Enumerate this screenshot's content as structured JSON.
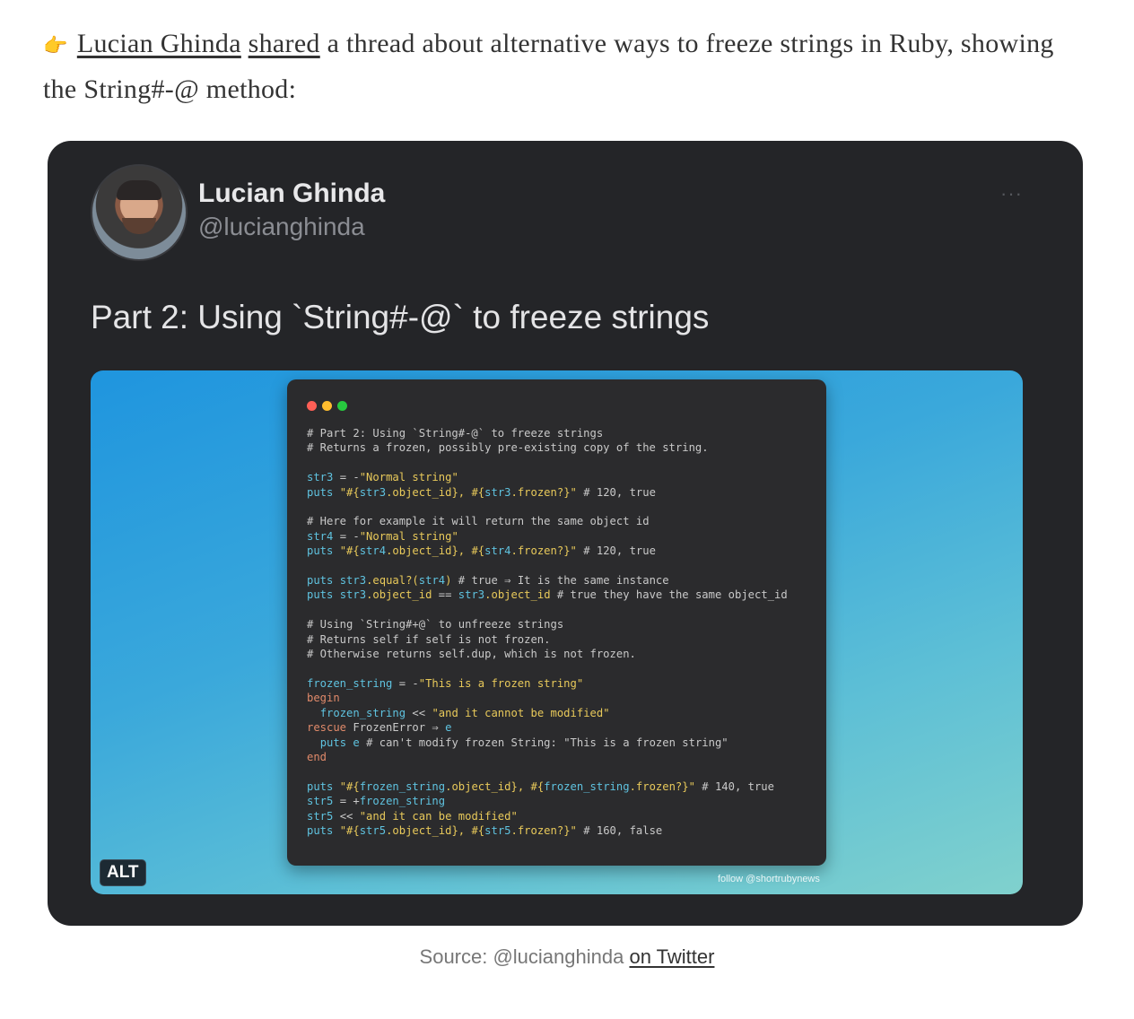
{
  "intro": {
    "emoji": "👉",
    "author_link": "Lucian Ghinda",
    "shared_link": "shared",
    "text_after": "a thread about alternative ways to freeze strings in Ruby, showing the String#-@ method:"
  },
  "tweet": {
    "name": "Lucian Ghinda",
    "handle": "@lucianghinda",
    "more": "···",
    "text": "Part 2: Using `String#-@` to freeze strings",
    "alt_badge": "ALT",
    "watermark": "follow @shortrubynews",
    "window_dots": [
      "#ff5f56",
      "#ffbd2e",
      "#27c93f"
    ],
    "code_lines": [
      [
        [
          "c",
          "# Part 2: Using `String#-@` to freeze strings"
        ]
      ],
      [
        [
          "c",
          "# Returns a frozen, possibly pre-existing copy of the string."
        ]
      ],
      [],
      [
        [
          "v",
          "str3"
        ],
        [
          "c",
          " = -"
        ],
        [
          "s",
          "\"Normal string\""
        ]
      ],
      [
        [
          "v",
          "puts"
        ],
        [
          "c",
          " "
        ],
        [
          "s",
          "\"#{"
        ],
        [
          "v",
          "str3"
        ],
        [
          "s",
          ".object_id}, #{"
        ],
        [
          "v",
          "str3"
        ],
        [
          "s",
          ".frozen?}\""
        ],
        [
          "c",
          " # 120, true"
        ]
      ],
      [],
      [
        [
          "c",
          "# Here for example it will return the same object id"
        ]
      ],
      [
        [
          "v",
          "str4"
        ],
        [
          "c",
          " = -"
        ],
        [
          "s",
          "\"Normal string\""
        ]
      ],
      [
        [
          "v",
          "puts"
        ],
        [
          "c",
          " "
        ],
        [
          "s",
          "\"#{"
        ],
        [
          "v",
          "str4"
        ],
        [
          "s",
          ".object_id}, #{"
        ],
        [
          "v",
          "str4"
        ],
        [
          "s",
          ".frozen?}\""
        ],
        [
          "c",
          " # 120, true"
        ]
      ],
      [],
      [
        [
          "v",
          "puts"
        ],
        [
          "c",
          " "
        ],
        [
          "v",
          "str3"
        ],
        [
          "s",
          ".equal?("
        ],
        [
          "v",
          "str4"
        ],
        [
          "s",
          ")"
        ],
        [
          "c",
          " # true ⇒ It is the same instance"
        ]
      ],
      [
        [
          "v",
          "puts"
        ],
        [
          "c",
          " "
        ],
        [
          "v",
          "str3"
        ],
        [
          "s",
          ".object_id"
        ],
        [
          "c",
          " == "
        ],
        [
          "v",
          "str3"
        ],
        [
          "s",
          ".object_id"
        ],
        [
          "c",
          " # true they have the same object_id"
        ]
      ],
      [],
      [
        [
          "c",
          "# Using `String#+@` to unfreeze strings"
        ]
      ],
      [
        [
          "c",
          "# Returns self if self is not frozen."
        ]
      ],
      [
        [
          "c",
          "# Otherwise returns self.dup, which is not frozen."
        ]
      ],
      [],
      [
        [
          "v",
          "frozen_string"
        ],
        [
          "c",
          " = -"
        ],
        [
          "s",
          "\"This is a frozen string\""
        ]
      ],
      [
        [
          "k",
          "begin"
        ]
      ],
      [
        [
          "c",
          "  "
        ],
        [
          "v",
          "frozen_string"
        ],
        [
          "c",
          " << "
        ],
        [
          "s",
          "\"and it cannot be modified\""
        ]
      ],
      [
        [
          "k",
          "rescue"
        ],
        [
          "c",
          " FrozenError ⇒ "
        ],
        [
          "v",
          "e"
        ]
      ],
      [
        [
          "c",
          "  "
        ],
        [
          "v",
          "puts"
        ],
        [
          "c",
          " "
        ],
        [
          "v",
          "e"
        ],
        [
          "c",
          " # can't modify frozen String: \"This is a frozen string\""
        ]
      ],
      [
        [
          "k",
          "end"
        ]
      ],
      [],
      [
        [
          "v",
          "puts"
        ],
        [
          "c",
          " "
        ],
        [
          "s",
          "\"#{"
        ],
        [
          "v",
          "frozen_string"
        ],
        [
          "s",
          ".object_id}, #{"
        ],
        [
          "v",
          "frozen_string"
        ],
        [
          "s",
          ".frozen?}\""
        ],
        [
          "c",
          " # 140, true"
        ]
      ],
      [
        [
          "v",
          "str5"
        ],
        [
          "c",
          " = +"
        ],
        [
          "v",
          "frozen_string"
        ]
      ],
      [
        [
          "v",
          "str5"
        ],
        [
          "c",
          " << "
        ],
        [
          "s",
          "\"and it can be modified\""
        ]
      ],
      [
        [
          "v",
          "puts"
        ],
        [
          "c",
          " "
        ],
        [
          "s",
          "\"#{"
        ],
        [
          "v",
          "str5"
        ],
        [
          "s",
          ".object_id}, #{"
        ],
        [
          "v",
          "str5"
        ],
        [
          "s",
          ".frozen?}\""
        ],
        [
          "c",
          " # 160, false"
        ]
      ]
    ]
  },
  "caption": {
    "prefix": "Source: @lucianghinda",
    "link": "on Twitter"
  }
}
